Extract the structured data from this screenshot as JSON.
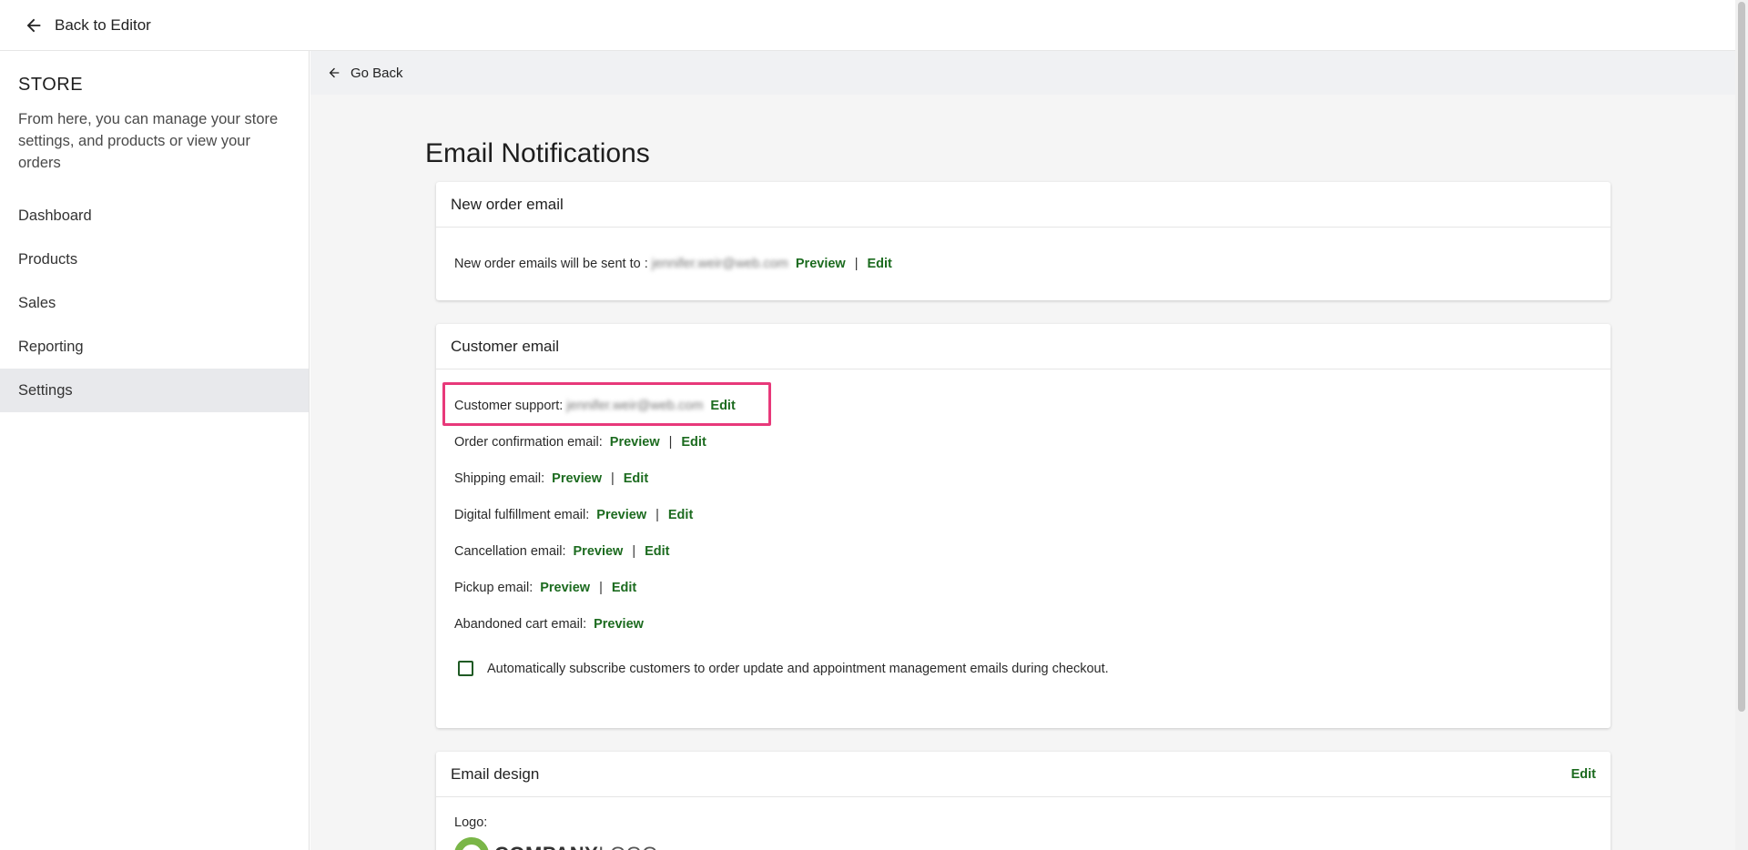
{
  "topbar": {
    "back_label": "Back to Editor"
  },
  "sidebar": {
    "title": "STORE",
    "description": "From here, you can manage your store settings, and products or view your orders",
    "items": [
      {
        "label": "Dashboard"
      },
      {
        "label": "Products"
      },
      {
        "label": "Sales"
      },
      {
        "label": "Reporting"
      },
      {
        "label": "Settings"
      }
    ]
  },
  "subbar": {
    "go_back_label": "Go Back"
  },
  "page": {
    "title": "Email Notifications"
  },
  "new_order_card": {
    "title": "New order email",
    "sent_to_label": "New order emails will be sent to :",
    "email": "jennifer.weir@web.com",
    "preview_label": "Preview",
    "separator": "|",
    "edit_label": "Edit"
  },
  "customer_card": {
    "title": "Customer email",
    "support_label": "Customer support:",
    "support_email": "jennifer.weir@web.com",
    "support_edit": "Edit",
    "rows": [
      {
        "label": "Order confirmation email:",
        "preview": "Preview",
        "sep": "|",
        "edit": "Edit"
      },
      {
        "label": "Shipping email:",
        "preview": "Preview",
        "sep": "|",
        "edit": "Edit"
      },
      {
        "label": "Digital fulfillment email:",
        "preview": "Preview",
        "sep": "|",
        "edit": "Edit"
      },
      {
        "label": "Cancellation email:",
        "preview": "Preview",
        "sep": "|",
        "edit": "Edit"
      },
      {
        "label": "Pickup email:",
        "preview": "Preview",
        "sep": "|",
        "edit": "Edit"
      },
      {
        "label": "Abandoned cart email:",
        "preview": "Preview"
      }
    ],
    "checkbox_label": "Automatically subscribe customers to order update and appointment management emails during checkout."
  },
  "design_card": {
    "title": "Email design",
    "edit_label": "Edit",
    "logo_label": "Logo:",
    "logo_word_bold": "COMPANY",
    "logo_word_thin": "LOGO"
  },
  "colors": {
    "accent": "#1c6b1f",
    "highlight": "#e8397a",
    "logo_green": "#7ab648"
  }
}
